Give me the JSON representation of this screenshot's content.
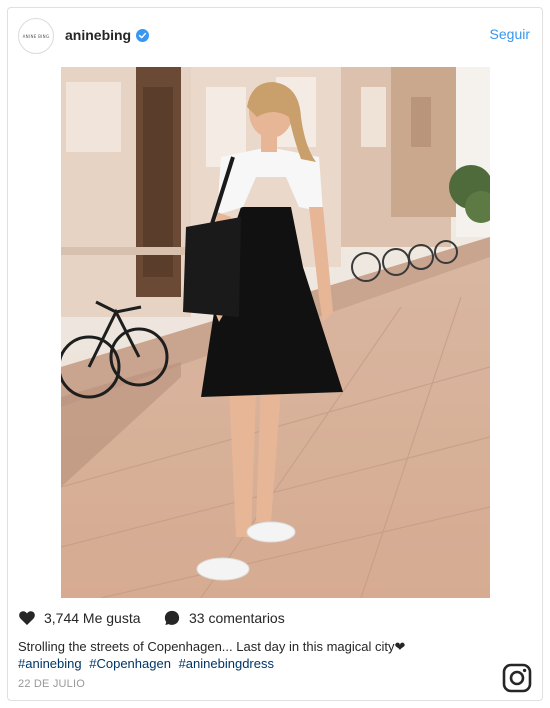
{
  "header": {
    "avatar_text": "ANINE BING",
    "username": "aninebing",
    "follow_label": "Seguir"
  },
  "photo": {
    "alt": "Woman in black slip dress over white t-shirt and white sneakers on a city sidewalk"
  },
  "actions": {
    "likes_label": "3,744 Me gusta",
    "comments_label": "33 comentarios"
  },
  "caption": {
    "text": "Strolling the streets of Copenhagen... Last day in this magical city❤︎"
  },
  "hashtags": [
    "#aninebing",
    "#Copenhagen",
    "#aninebingdress"
  ],
  "date": "22 DE JULIO",
  "icons": {
    "verified": "verified-badge-icon",
    "like": "heart-icon",
    "comment": "comment-bubble-icon",
    "brand": "instagram-icon"
  },
  "colors": {
    "link_blue": "#3897f0",
    "hashtag": "#003569",
    "text": "#262626",
    "muted": "#999999"
  }
}
